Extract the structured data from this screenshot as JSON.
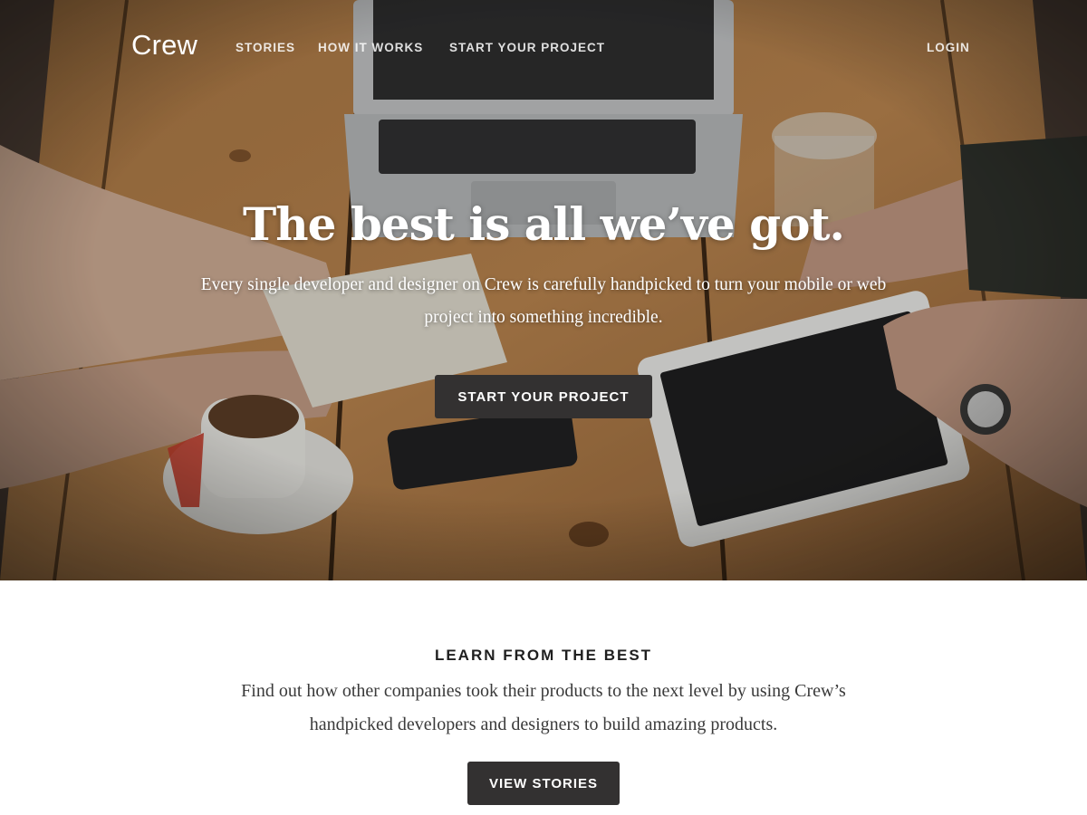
{
  "brand": {
    "logo_text": "Crew"
  },
  "nav": {
    "items": [
      {
        "label": "STORIES"
      },
      {
        "label": "HOW IT WORKS"
      },
      {
        "label": "START YOUR PROJECT"
      }
    ],
    "login_label": "LOGIN"
  },
  "hero": {
    "title": "The best is all we’ve got.",
    "subtitle": "Every single developer and designer on Crew is carefully handpicked to turn your mobile or web project into something incredible.",
    "cta_label": "START YOUR PROJECT",
    "background_icon": "workspace-photo"
  },
  "learn": {
    "heading": "LEARN FROM THE BEST",
    "body": "Find out how other companies took their products to the next level by using Crew’s handpicked developers and designers to build amazing products.",
    "cta_label": "VIEW STORIES"
  },
  "colors": {
    "button_bg": "#333131",
    "text_dark": "#1f1f1f",
    "wood": "#a86f3a"
  }
}
